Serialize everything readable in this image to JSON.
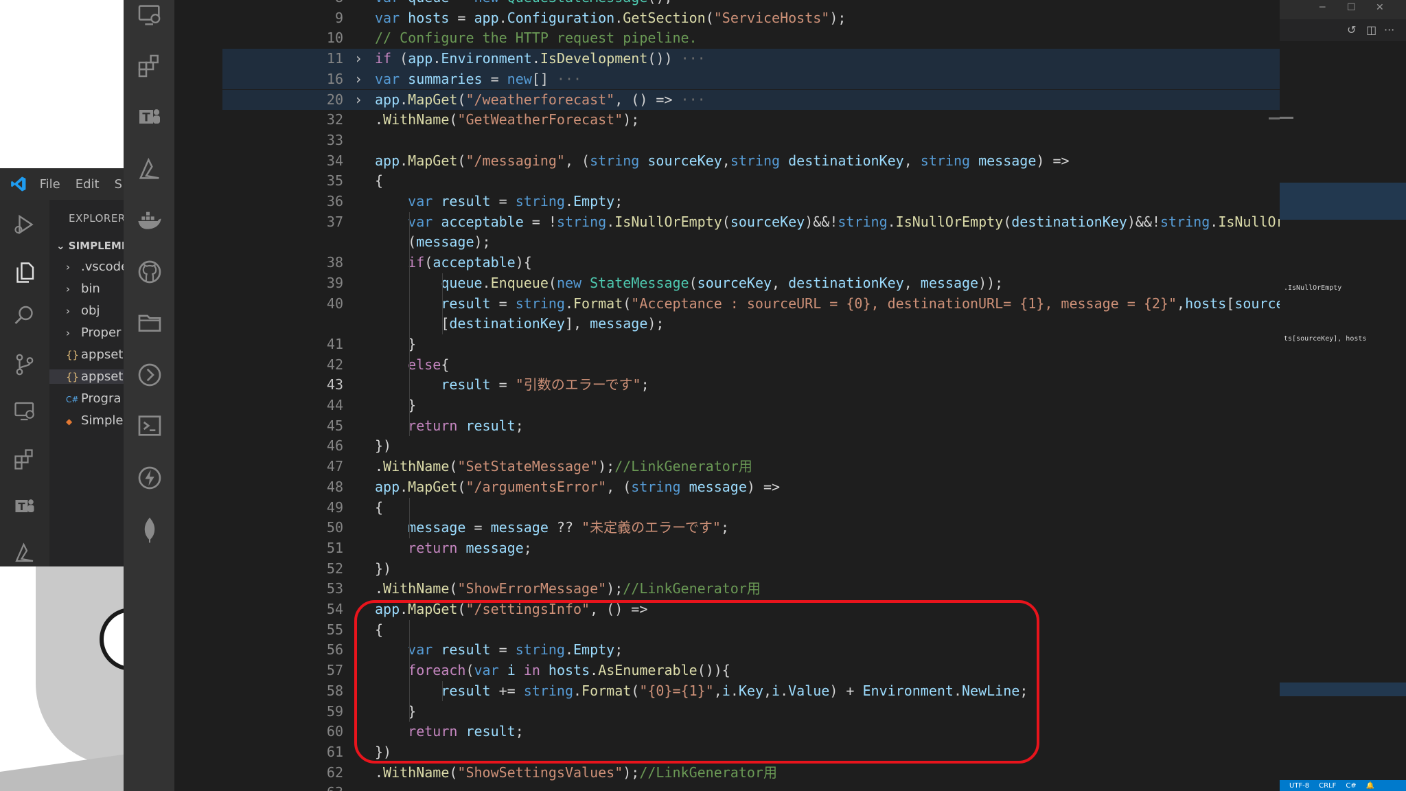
{
  "background_window": {
    "menu": [
      "File",
      "Edit",
      "S"
    ],
    "explorer_title": "EXPLORER",
    "project_root": "SIMPLEME",
    "files": [
      {
        "icon": "›",
        "name": ".vscode"
      },
      {
        "icon": "›",
        "name": "bin"
      },
      {
        "icon": "›",
        "name": "obj"
      },
      {
        "icon": "›",
        "name": "Proper"
      },
      {
        "icon": "{}",
        "name": "appset"
      },
      {
        "icon": "{}",
        "name": "appset"
      },
      {
        "icon": "C#",
        "name": "Progra"
      },
      {
        "icon": "◆",
        "name": "Simple"
      }
    ]
  },
  "editor": {
    "lines": [
      {
        "n": "8",
        "html": "<span class=\"k\">var</span> <span class=\"v\">queue</span> = <span class=\"k\">new</span> <span class=\"t\">QueueStateMessage</span>();"
      },
      {
        "n": "9",
        "html": "<span class=\"k\">var</span> <span class=\"v\">hosts</span> = <span class=\"v\">app</span>.<span class=\"v\">Configuration</span>.<span class=\"f\">GetSection</span>(<span class=\"s\">\"ServiceHosts\"</span>);"
      },
      {
        "n": "10",
        "html": "<span class=\"c\">// Configure the HTTP request pipeline.</span>"
      },
      {
        "n": "11",
        "fold": "›",
        "hl": true,
        "html": "<span class=\"p\">if</span> (<span class=\"v\">app</span>.<span class=\"v\">Environment</span>.<span class=\"f\">IsDevelopment</span>()) <span class=\"dim\">···</span>"
      },
      {
        "n": "16",
        "fold": "›",
        "hl": true,
        "html": "<span class=\"k\">var</span> <span class=\"v\">summaries</span> = <span class=\"k\">new</span>[] <span class=\"dim\">···</span>"
      },
      {
        "n": "20",
        "fold": "›",
        "hl": true,
        "html": "<span class=\"v\">app</span>.<span class=\"f\">MapGet</span>(<span class=\"s\">\"/weatherforecast\"</span>, () =&gt; <span class=\"dim\">···</span>"
      },
      {
        "n": "32",
        "html": ".<span class=\"f\">WithName</span>(<span class=\"s\">\"GetWeatherForecast\"</span>);"
      },
      {
        "n": "33",
        "html": ""
      },
      {
        "n": "34",
        "html": "<span class=\"v\">app</span>.<span class=\"f\">MapGet</span>(<span class=\"s\">\"/messaging\"</span>, (<span class=\"k\">string</span> <span class=\"v\">sourceKey</span>,<span class=\"k\">string</span> <span class=\"v\">destinationKey</span>, <span class=\"k\">string</span> <span class=\"v\">message</span>) =&gt;"
      },
      {
        "n": "35",
        "html": "{"
      },
      {
        "n": "36",
        "html": "    <span class=\"k\">var</span> <span class=\"v\">result</span> = <span class=\"k\">string</span>.<span class=\"v\">Empty</span>;"
      },
      {
        "n": "37",
        "html": "    <span class=\"k\">var</span> <span class=\"v\">acceptable</span> = !<span class=\"k\">string</span>.<span class=\"f\">IsNullOrEmpty</span>(<span class=\"v\">sourceKey</span>)&amp;&amp;!<span class=\"k\">string</span>.<span class=\"f\">IsNullOrEmpty</span>(<span class=\"v\">destinationKey</span>)&amp;&amp;!<span class=\"k\">string</span>.<span class=\"f\">IsNullOrEmpty</span>"
      },
      {
        "n": "",
        "html": "    (<span class=\"v\">message</span>);"
      },
      {
        "n": "38",
        "html": "    <span class=\"p\">if</span>(<span class=\"v\">acceptable</span>){"
      },
      {
        "n": "39",
        "html": "        <span class=\"v\">queue</span>.<span class=\"f\">Enqueue</span>(<span class=\"k\">new</span> <span class=\"t\">StateMessage</span>(<span class=\"v\">sourceKey</span>, <span class=\"v\">destinationKey</span>, <span class=\"v\">message</span>));"
      },
      {
        "n": "40",
        "html": "        <span class=\"v\">result</span> = <span class=\"k\">string</span>.<span class=\"f\">Format</span>(<span class=\"s\">\"Acceptance : sourceURL = {0}, destinationURL= {1}, message = {2}\"</span>,<span class=\"v\">hosts</span>[<span class=\"v\">sourceKey</span>], <span class=\"v\">hosts</span>"
      },
      {
        "n": "",
        "html": "        [<span class=\"v\">destinationKey</span>], <span class=\"v\">message</span>);"
      },
      {
        "n": "41",
        "html": "    }"
      },
      {
        "n": "42",
        "html": "    <span class=\"p\">else</span>{"
      },
      {
        "n": "43",
        "active": true,
        "html": "        <span class=\"v\">result</span> = <span class=\"s\">\"引数のエラーです\"</span>;"
      },
      {
        "n": "44",
        "html": "    }"
      },
      {
        "n": "45",
        "html": "    <span class=\"p\">return</span> <span class=\"v\">result</span>;"
      },
      {
        "n": "46",
        "html": "})"
      },
      {
        "n": "47",
        "html": ".<span class=\"f\">WithName</span>(<span class=\"s\">\"SetStateMessage\"</span>);<span class=\"c\">//LinkGenerator用</span>"
      },
      {
        "n": "48",
        "html": "<span class=\"v\">app</span>.<span class=\"f\">MapGet</span>(<span class=\"s\">\"/argumentsError\"</span>, (<span class=\"k\">string</span> <span class=\"v\">message</span>) =&gt;"
      },
      {
        "n": "49",
        "html": "{"
      },
      {
        "n": "50",
        "html": "    <span class=\"v\">message</span> = <span class=\"v\">message</span> ?? <span class=\"s\">\"未定義のエラーです\"</span>;"
      },
      {
        "n": "51",
        "html": "    <span class=\"p\">return</span> <span class=\"v\">message</span>;"
      },
      {
        "n": "52",
        "html": "})"
      },
      {
        "n": "53",
        "html": ".<span class=\"f\">WithName</span>(<span class=\"s\">\"ShowErrorMessage\"</span>);<span class=\"c\">//LinkGenerator用</span>"
      },
      {
        "n": "54",
        "html": "<span class=\"v\">app</span>.<span class=\"f\">MapGet</span>(<span class=\"s\">\"/settingsInfo\"</span>, () =&gt;"
      },
      {
        "n": "55",
        "html": "{"
      },
      {
        "n": "56",
        "html": "    <span class=\"k\">var</span> <span class=\"v\">result</span> = <span class=\"k\">string</span>.<span class=\"v\">Empty</span>;"
      },
      {
        "n": "57",
        "html": "    <span class=\"p\">foreach</span>(<span class=\"k\">var</span> <span class=\"v\">i</span> <span class=\"p\">in</span> <span class=\"v\">hosts</span>.<span class=\"f\">AsEnumerable</span>()){"
      },
      {
        "n": "58",
        "html": "        <span class=\"v\">result</span> += <span class=\"k\">string</span>.<span class=\"f\">Format</span>(<span class=\"s\">\"{0}={1}\"</span>,<span class=\"v\">i</span>.<span class=\"v\">Key</span>,<span class=\"v\">i</span>.<span class=\"v\">Value</span>) + <span class=\"v\">Environment</span>.<span class=\"v\">NewLine</span>;"
      },
      {
        "n": "59",
        "html": "    }"
      },
      {
        "n": "60",
        "html": "    <span class=\"p\">return</span> <span class=\"v\">result</span>;"
      },
      {
        "n": "61",
        "html": "})"
      },
      {
        "n": "62",
        "html": ".<span class=\"f\">WithName</span>(<span class=\"s\">\"ShowSettingsValues\"</span>);<span class=\"c\">//LinkGenerator用</span>"
      },
      {
        "n": "63",
        "html": ""
      }
    ]
  },
  "right_panel": {
    "minimap_text_1": ".IsNullOrEmpty",
    "minimap_text_2": "ts[sourceKey], hosts",
    "status_items": [
      "UTF-8",
      "CRLF",
      "C#"
    ]
  },
  "colors": {
    "highlight_box": "#e8141c",
    "accent": "#007acc"
  }
}
